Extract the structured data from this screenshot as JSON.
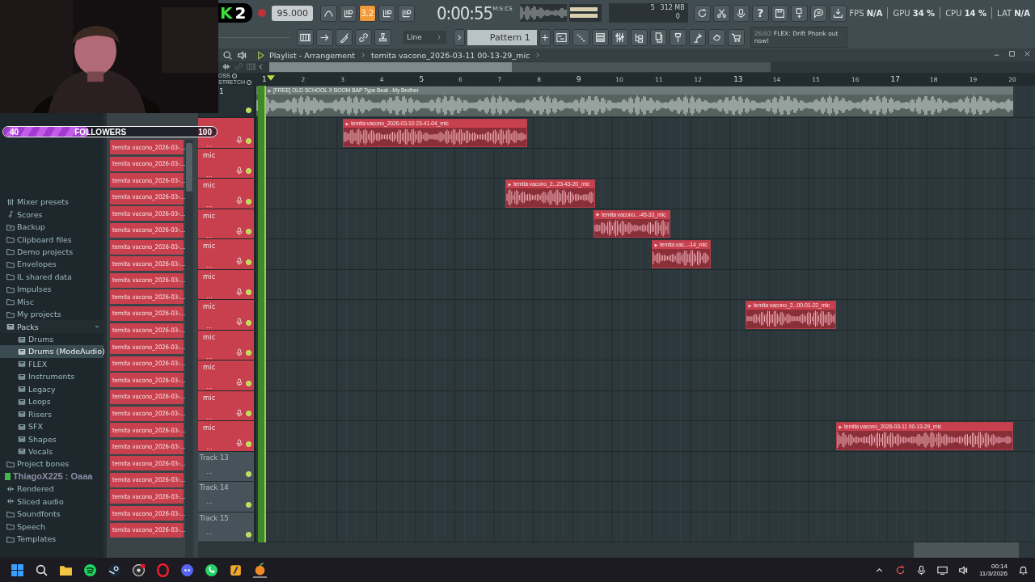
{
  "stream_overlay": {
    "badge": {
      "letter": "K",
      "number": "2"
    },
    "followers": {
      "current": "40",
      "label": "FOLLOWERS",
      "goal": "100",
      "level": 0.4
    }
  },
  "toolbar": {
    "tempo": "95.000",
    "step_toggle": {
      "label": "3.2",
      "on": true
    },
    "time": "0:00:55",
    "time_unit": "M:S:CS",
    "voices": "5",
    "memory": "312 MB",
    "cpu_count": "0",
    "help": "?",
    "snap": "Line",
    "pattern": "Pattern 1",
    "news": {
      "date": "26/02",
      "text": "FLEX: Drift Phonk out now!"
    },
    "stats": [
      {
        "label": "FPS",
        "value": "N/A"
      },
      {
        "label": "GPU",
        "value": "34 %"
      },
      {
        "label": "CPU",
        "value": "14 %"
      },
      {
        "label": "LAT",
        "value": "N/A"
      }
    ]
  },
  "browser": {
    "items": [
      {
        "label": "Mixer presets",
        "kind": "preset",
        "selected": false
      },
      {
        "label": "Scores",
        "kind": "note",
        "selected": false
      },
      {
        "label": "Backup",
        "kind": "backup",
        "selected": false
      },
      {
        "label": "Clipboard files",
        "kind": "folder",
        "selected": false
      },
      {
        "label": "Demo projects",
        "kind": "folder",
        "selected": false
      },
      {
        "label": "Envelopes",
        "kind": "folder",
        "selected": false
      },
      {
        "label": "IL shared data",
        "kind": "folder",
        "selected": false
      },
      {
        "label": "Impulses",
        "kind": "folder",
        "selected": false
      },
      {
        "label": "Misc",
        "kind": "folder",
        "selected": false
      },
      {
        "label": "My projects",
        "kind": "folder",
        "selected": false
      },
      {
        "label": "Packs",
        "kind": "pack",
        "selected": false,
        "expanded": true,
        "children": [
          {
            "label": "Drums",
            "kind": "pack",
            "selected": false
          },
          {
            "label": "Drums (ModeAudio)",
            "kind": "pack",
            "selected": true
          },
          {
            "label": "FLEX",
            "kind": "pack",
            "selected": false
          },
          {
            "label": "Instruments",
            "kind": "pack",
            "selected": false
          },
          {
            "label": "Legacy",
            "kind": "pack",
            "selected": false
          },
          {
            "label": "Loops",
            "kind": "pack",
            "selected": false
          },
          {
            "label": "Risers",
            "kind": "pack",
            "selected": false
          },
          {
            "label": "SFX",
            "kind": "pack",
            "selected": false
          },
          {
            "label": "Shapes",
            "kind": "pack",
            "selected": false
          },
          {
            "label": "Vocals",
            "kind": "pack",
            "selected": false
          }
        ]
      },
      {
        "label": "Project bones",
        "kind": "folder",
        "selected": false
      },
      {
        "label": "ThiagoX225 : Oaaa",
        "kind": "chat"
      },
      {
        "label": "Rendered",
        "kind": "audio",
        "selected": false
      },
      {
        "label": "Sliced audio",
        "kind": "audio",
        "selected": false
      },
      {
        "label": "Soundfonts",
        "kind": "folder",
        "selected": false
      },
      {
        "label": "Speech",
        "kind": "folder",
        "selected": false
      },
      {
        "label": "Templates",
        "kind": "folder",
        "selected": false
      }
    ]
  },
  "channel_rack": {
    "channels": [
      "temita vacono_2026-03-...",
      "temita vacono_2026-03-...",
      "temita vacono_2026-03-...",
      "temita vacono_2026-03-...",
      "temita vacono_2026-03-...",
      "temita vacono_2026-03-...",
      "temita vacono_2026-03-...",
      "temita vacono_2026-03-...",
      "temita vacono_2026-03-...",
      "temita vacono_2026-03-...",
      "temita vacono_2026-03-...",
      "temita vacono_2026-03-...",
      "temita vacono_2026-03-...",
      "temita vacono_2026-03-...",
      "temita vacono_2026-03-...",
      "temita vacono_2026-03-...",
      "temita vacono_2026-03-...",
      "temita vacono_2026-03-...",
      "temita vacono_2026-03-...",
      "temita vacono_2026-03-...",
      "temita vacono_2026-03-...",
      "temita vacono_2026-03-...",
      "temita vacono_2026-03-...",
      "temita vacono_2026-03-..."
    ]
  },
  "playlist": {
    "title": "Playlist - Arrangement",
    "breadcrumb": "temita vacono_2026-03-11 00-13-29_mic",
    "options": [
      {
        "label": "OSS",
        "checked": false
      },
      {
        "label": "STRETCH",
        "checked": false
      }
    ],
    "ruler": [
      "1",
      "2",
      "3",
      "4",
      "5",
      "6",
      "7",
      "8",
      "9",
      "10",
      "11",
      "12",
      "13",
      "14",
      "15",
      "16",
      "17",
      "18",
      "19",
      "20"
    ],
    "tracks": [
      {
        "kind": "audio",
        "number": "1",
        "enabled": true,
        "clips": [
          {
            "label": "[FREE] OLD SCHOOL X BOOM BAP Type Beat - My Brother"
          }
        ]
      },
      {
        "kind": "mic",
        "options": "...",
        "enabled": true,
        "clips": [
          {
            "label": "temita vacono_2026-03-10 23-41-04_mic"
          }
        ]
      },
      {
        "kind": "mic",
        "name": "mic",
        "options": "...",
        "enabled": true
      },
      {
        "kind": "mic",
        "name": "mic",
        "options": "...",
        "enabled": true,
        "clips": [
          {
            "label": "temita vacono_2...23-43-20_mic"
          }
        ]
      },
      {
        "kind": "mic",
        "name": "mic",
        "options": "...",
        "enabled": true,
        "clips": [
          {
            "label": "temita vacono...-45-33_mic"
          }
        ]
      },
      {
        "kind": "mic",
        "name": "mic",
        "options": "...",
        "enabled": true,
        "clips": [
          {
            "label": "temita vac...-14_mic"
          }
        ]
      },
      {
        "kind": "mic",
        "name": "mic",
        "options": "...",
        "enabled": true
      },
      {
        "kind": "mic",
        "name": "mic",
        "options": "...",
        "enabled": true,
        "clips": [
          {
            "label": "temita vacono_2...00-01-22_mic"
          }
        ]
      },
      {
        "kind": "mic",
        "name": "mic",
        "options": "...",
        "enabled": true
      },
      {
        "kind": "mic",
        "name": "mic",
        "options": "...",
        "enabled": true
      },
      {
        "kind": "mic",
        "name": "mic",
        "options": "...",
        "enabled": true
      },
      {
        "kind": "mic",
        "name": "mic",
        "options": "...",
        "enabled": true,
        "clips": [
          {
            "label": "temita vacono_2026-03-11 00-13-29_mic"
          }
        ]
      },
      {
        "kind": "empty",
        "name": "Track 13",
        "options": "...",
        "enabled": true
      },
      {
        "kind": "empty",
        "name": "Track 14",
        "options": "...",
        "enabled": true
      },
      {
        "kind": "empty",
        "name": "Track 15",
        "options": "...",
        "enabled": true
      }
    ]
  },
  "taskbar": {
    "time": "00:14",
    "date": "11/3/2026"
  }
}
